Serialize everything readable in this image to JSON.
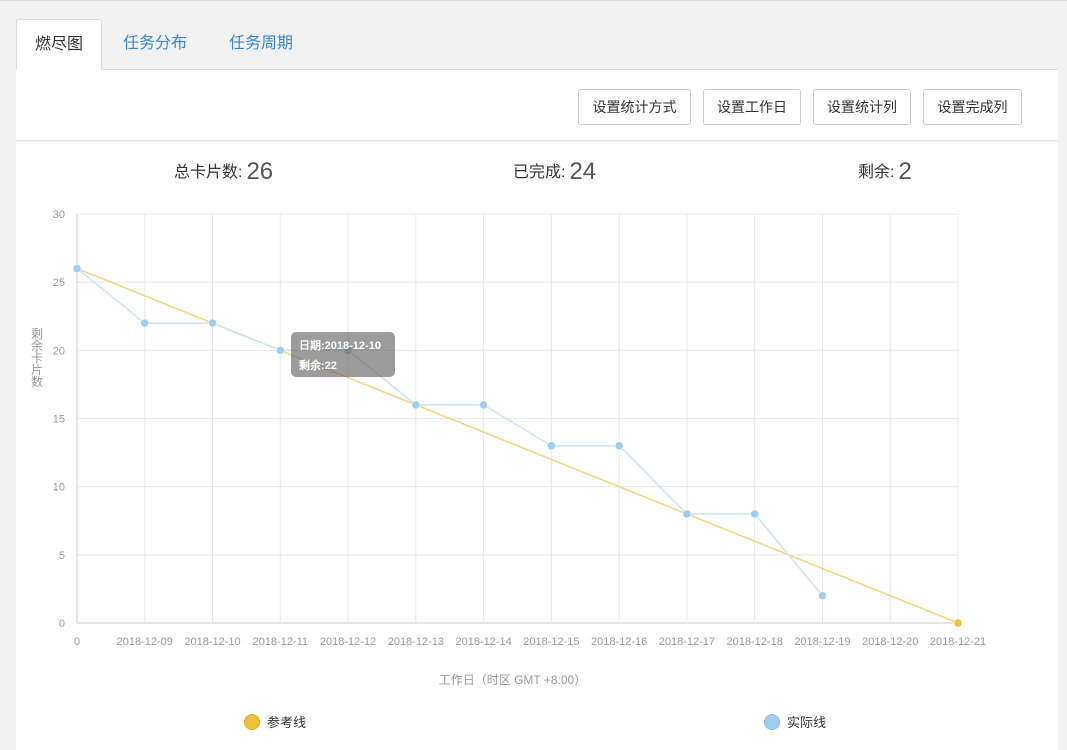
{
  "tabs": [
    {
      "label": "燃尽图",
      "active": true
    },
    {
      "label": "任务分布",
      "active": false
    },
    {
      "label": "任务周期",
      "active": false
    }
  ],
  "toolbar": {
    "buttons": [
      "设置统计方式",
      "设置工作日",
      "设置统计列",
      "设置完成列"
    ]
  },
  "stats": {
    "total_label": "总卡片数:",
    "total_value": "26",
    "done_label": "已完成:",
    "done_value": "24",
    "remaining_label": "剩余:",
    "remaining_value": "2"
  },
  "colors": {
    "reference": "#f5d27e",
    "reference_point": "#f0c23c",
    "actual": "#c8e3f5",
    "actual_point": "#9fcdf0",
    "grid": "#e8e8e8",
    "tab_link": "#3c87c9"
  },
  "tooltip": {
    "line1": "日期:2018-12-10",
    "line2": "剩余:22"
  },
  "chart_data": {
    "type": "line",
    "categories": [
      "0",
      "2018-12-09",
      "2018-12-10",
      "2018-12-11",
      "2018-12-12",
      "2018-12-13",
      "2018-12-14",
      "2018-12-15",
      "2018-12-16",
      "2018-12-17",
      "2018-12-18",
      "2018-12-19",
      "2018-12-20",
      "2018-12-21"
    ],
    "series": [
      {
        "name": "参考线",
        "values": [
          26,
          null,
          null,
          null,
          null,
          null,
          null,
          null,
          null,
          null,
          null,
          null,
          null,
          0
        ]
      },
      {
        "name": "实际线",
        "values": [
          26,
          22,
          22,
          20,
          20,
          16,
          16,
          13,
          13,
          8,
          8,
          2,
          null,
          null
        ]
      }
    ],
    "ylim": [
      0,
      30
    ],
    "yticks": [
      0,
      5,
      10,
      15,
      20,
      25,
      30
    ],
    "xlabel": "工作日（时区 GMT +8:00）",
    "ylabel": "剩余卡片数",
    "legend_position": "bottom",
    "grid": true
  }
}
